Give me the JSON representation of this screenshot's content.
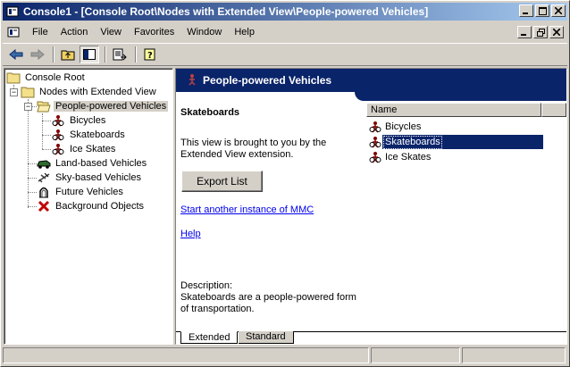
{
  "window": {
    "title": "Console1 - [Console Root\\Nodes with Extended View\\People-powered Vehicles]"
  },
  "menu": {
    "items": [
      {
        "label": "File"
      },
      {
        "label": "Action"
      },
      {
        "label": "View"
      },
      {
        "label": "Favorites"
      },
      {
        "label": "Window"
      },
      {
        "label": "Help"
      }
    ]
  },
  "toolbar": {
    "tools": [
      "back-icon",
      "forward-icon",
      "up-folder-icon",
      "show-hide-tree-icon",
      "export-list-icon",
      "help-icon"
    ]
  },
  "tree": {
    "nodes": [
      {
        "label": "Console Root",
        "icon": "folder-icon"
      },
      {
        "label": "Nodes with Extended View",
        "icon": "folder-icon"
      },
      {
        "label": "People-powered Vehicles",
        "icon": "open-folder-icon",
        "selected": true
      },
      {
        "label": "Bicycles",
        "icon": "vehicle-icon"
      },
      {
        "label": "Skateboards",
        "icon": "vehicle-icon"
      },
      {
        "label": "Ice Skates",
        "icon": "vehicle-icon"
      },
      {
        "label": "Land-based Vehicles",
        "icon": "car-icon"
      },
      {
        "label": "Sky-based Vehicles",
        "icon": "plane-icon"
      },
      {
        "label": "Future Vehicles",
        "icon": "rocket-icon"
      },
      {
        "label": "Background Objects",
        "icon": "red-x-icon"
      }
    ]
  },
  "right": {
    "banner_title": "People-powered Vehicles",
    "ext_title": "Skateboards",
    "ext_text": "This view is brought to you by the Extended View extension.",
    "export_button": "Export List",
    "link_start": "Start another instance of MMC",
    "link_help": "Help",
    "description_label": "Description:",
    "description_text": "Skateboards are a people-powered form of transportation."
  },
  "listview": {
    "column": "Name",
    "items": [
      {
        "label": "Bicycles"
      },
      {
        "label": "Skateboards",
        "selected": true
      },
      {
        "label": "Ice Skates"
      }
    ]
  },
  "tabs": [
    {
      "label": "Extended",
      "active": true
    },
    {
      "label": "Standard",
      "active": false
    }
  ],
  "colors": {
    "title_bar": "#0a246a",
    "selection": "#0a246a",
    "link": "#0000ee",
    "face": "#d4d0c8"
  }
}
